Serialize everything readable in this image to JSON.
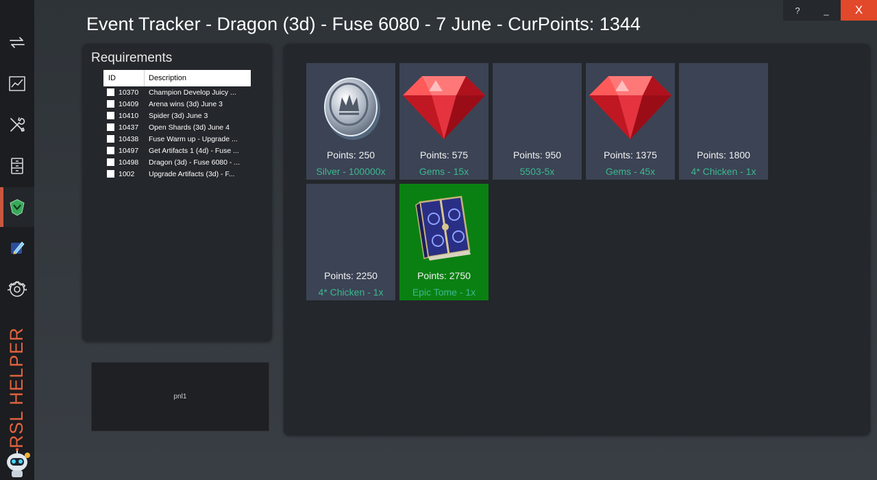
{
  "app": {
    "title": "Event Tracker - Dragon (3d) - Fuse 6080 - 7 June - CurPoints: 1344",
    "brand": "RSL HELPER"
  },
  "window_controls": {
    "help": "?",
    "minimize": "_",
    "close": "X"
  },
  "sidebar": {
    "items": [
      {
        "icon": "sync-arrows-icon"
      },
      {
        "icon": "chart-icon"
      },
      {
        "icon": "tools-icon"
      },
      {
        "icon": "archive-icon"
      },
      {
        "icon": "shield-icon",
        "active": true
      },
      {
        "icon": "gem-pen-icon"
      },
      {
        "icon": "gear-icon"
      }
    ],
    "accent_color": "#c8573f"
  },
  "requirements": {
    "title": "Requirements",
    "columns": [
      "ID",
      "Description"
    ],
    "rows": [
      {
        "id": "10370",
        "description": "Champion Develop Juicy ..."
      },
      {
        "id": "10409",
        "description": "Arena wins (3d) June 3"
      },
      {
        "id": "10410",
        "description": "Spider (3d) June 3"
      },
      {
        "id": "10437",
        "description": "Open Shards (3d) June 4"
      },
      {
        "id": "10438",
        "description": "Fuse Warm up - Upgrade ..."
      },
      {
        "id": "10497",
        "description": "Get Artifacts 1 (4d) - Fuse ..."
      },
      {
        "id": "10498",
        "description": "Dragon (3d) - Fuse 6080 - ..."
      },
      {
        "id": "1002",
        "description": "Upgrade Artifacts (3d) - F..."
      }
    ]
  },
  "pnl1": {
    "label": "pnl1"
  },
  "rewards": {
    "tiles": [
      {
        "points": "Points: 250",
        "reward": "Silver - 100000x",
        "icon": "silver-coin-icon",
        "completed": false
      },
      {
        "points": "Points: 575",
        "reward": "Gems - 15x",
        "icon": "gem-icon",
        "completed": false
      },
      {
        "points": "Points: 950",
        "reward": "5503-5x",
        "icon": "",
        "completed": false
      },
      {
        "points": "Points: 1375",
        "reward": "Gems - 45x",
        "icon": "gem-icon",
        "completed": false
      },
      {
        "points": "Points: 1800",
        "reward": "4* Chicken - 1x",
        "icon": "",
        "completed": false
      },
      {
        "points": "Points: 2250",
        "reward": "4* Chicken - 1x",
        "icon": "",
        "completed": false
      },
      {
        "points": "Points: 2750",
        "reward": "Epic Tome - 1x",
        "icon": "epic-tome-icon",
        "completed": true
      }
    ],
    "colors": {
      "tile": "#3b4354",
      "tile_completed": "#0b8012",
      "reward_text": "#3cb88f"
    }
  }
}
